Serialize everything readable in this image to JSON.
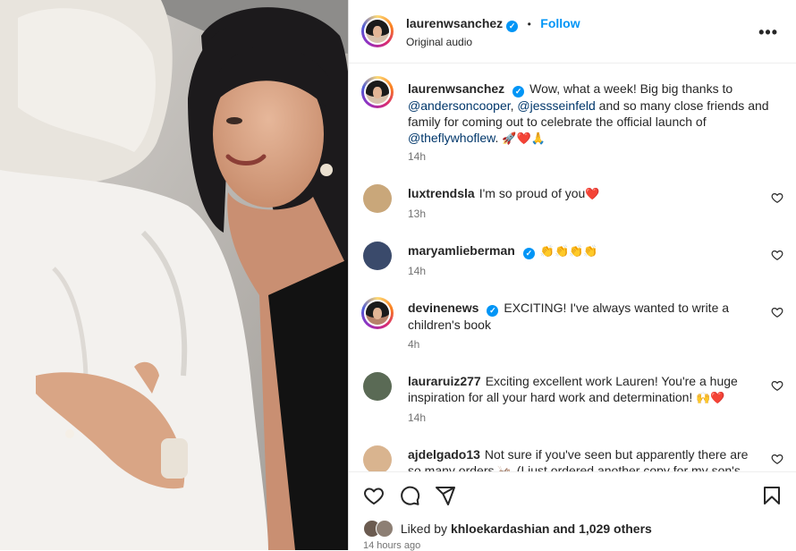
{
  "post": {
    "author": "laurenwsanchez",
    "dot": "•",
    "follow_label": "Follow",
    "audio": "Original audio",
    "caption_parts": [
      "Wow, what a week! Big big thanks to ",
      "@andersoncooper",
      ", ",
      "@jessseinfeld",
      " and so many close friends and family for coming out to celebrate the official launch of ",
      "@theflywhoflew",
      ". "
    ],
    "caption_emoji": "🚀❤️🙏",
    "caption_time": "14h",
    "more_icon": "more-options-icon"
  },
  "comments": [
    {
      "user": "luxtrendsla",
      "verified": false,
      "text": "I'm so proud of you",
      "emoji": "❤️",
      "time": "13h",
      "avatar_color": "#c9a77a"
    },
    {
      "user": "maryamlieberman",
      "verified": true,
      "text": "",
      "emoji": "👏👏👏👏",
      "time": "14h",
      "avatar_color": "#3a4a6b"
    },
    {
      "user": "devinenews",
      "verified": true,
      "text": "EXCITING! I've always wanted to write a children's book",
      "emoji": "",
      "time": "4h",
      "avatar_color": "#b7826a"
    },
    {
      "user": "lauraruiz277",
      "verified": false,
      "text": "Exciting excellent work Lauren! You're a huge inspiration for all your hard work and determination!",
      "emoji": "🙌❤️",
      "time": "14h",
      "avatar_color": "#5a6a55"
    },
    {
      "user": "ajdelgado13",
      "verified": false,
      "text": "Not sure if you've seen but apparently there are so many orders 🦗 (I just ordered another copy for my son's",
      "emoji": "",
      "time": "",
      "avatar_color": "#d9b48f"
    }
  ],
  "likes": {
    "prefix": "Liked by ",
    "user": "khloekardashian",
    "suffix": " and 1,029 others"
  },
  "posted_ago": "14 hours ago",
  "colors": {
    "accent": "#0095f6",
    "heart": "#ed1c24",
    "mention": "#00376b"
  }
}
